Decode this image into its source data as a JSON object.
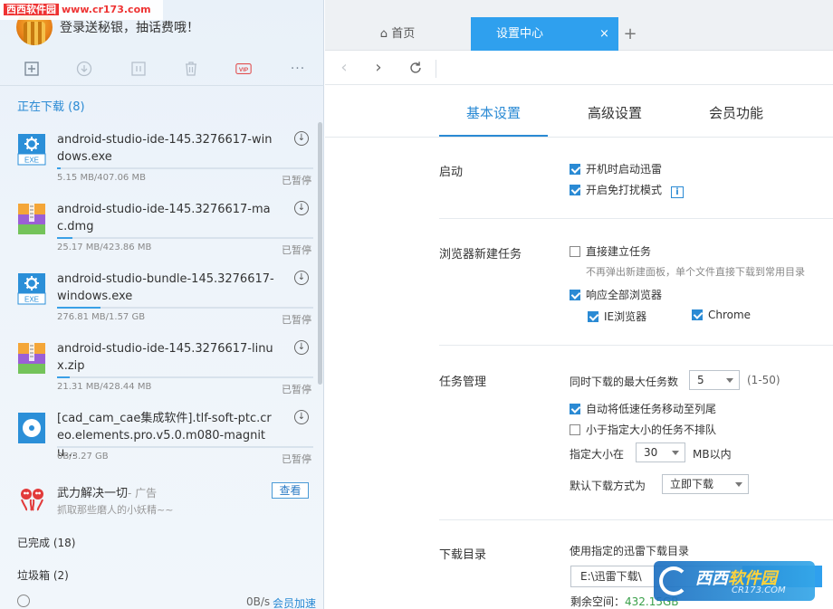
{
  "watermark": {
    "top_label": "西西软件园",
    "top_url": "www.cr173.com",
    "logo_text_a": "西西",
    "logo_text_b": "软件园",
    "logo_sub": "CR173.COM"
  },
  "user": {
    "login_prompt": "登录送秘银，抽话费哦！"
  },
  "toolbar": {
    "icons": [
      "add-task-icon",
      "download-icon",
      "pause-icon",
      "delete-icon",
      "vip-icon",
      "more-icon"
    ],
    "vip_label": "VIP",
    "more_label": "···"
  },
  "downloading": {
    "title": "正在下载 (8)",
    "items": [
      {
        "icon": "exe-icon",
        "icon_label": "EXE",
        "name": "android-studio-ide-145.3276617-windows.exe",
        "size": "5.15 MB/407.06 MB",
        "status": "已暂停",
        "progress": 0.013
      },
      {
        "icon": "archive-icon",
        "icon_label": "",
        "name": "android-studio-ide-145.3276617-mac.dmg",
        "size": "25.17 MB/423.86 MB",
        "status": "已暂停",
        "progress": 0.06
      },
      {
        "icon": "exe-icon",
        "icon_label": "EXE",
        "name": "android-studio-bundle-145.3276617-windows.exe",
        "size": "276.81 MB/1.57 GB",
        "status": "已暂停",
        "progress": 0.17
      },
      {
        "icon": "archive-icon",
        "icon_label": "",
        "name": "android-studio-ide-145.3276617-linux.zip",
        "size": "21.31 MB/428.44 MB",
        "status": "已暂停",
        "progress": 0.05
      },
      {
        "icon": "disc-icon",
        "icon_label": "",
        "name": "[cad_cam_cae集成软件].tlf-soft-ptc.creo.elements.pro.v5.0.m080-magnitu...",
        "size": "0B/3.27 GB",
        "status": "已暂停",
        "progress": 0
      }
    ]
  },
  "ad": {
    "title": "武力解决一切",
    "tag": "- 广告",
    "subtitle": "抓取那些磨人的小妖精~~",
    "button": "查看"
  },
  "sidebar": {
    "done": "已完成 (18)",
    "trash": "垃圾箱 (2)",
    "speed": "0B/s",
    "vip_accel": "会员加速"
  },
  "tabs": {
    "home": "首页",
    "active": "设置中心",
    "close": "×",
    "add": "+"
  },
  "settings_tabs": [
    "基本设置",
    "高级设置",
    "会员功能"
  ],
  "settings": {
    "startup": {
      "label": "启动",
      "opt1": "开机时启动迅雷",
      "opt2": "开启免打扰模式",
      "info": "i"
    },
    "browser": {
      "label": "浏览器新建任务",
      "direct": "直接建立任务",
      "direct_hint": "不再弹出新建面板，单个文件直接下载到常用目录",
      "respond_all": "响应全部浏览器",
      "ie": "IE浏览器",
      "chrome": "Chrome"
    },
    "task": {
      "label": "任务管理",
      "max_label": "同时下载的最大任务数",
      "max_value": "5",
      "max_range": "(1-50)",
      "auto_move": "自动将低速任务移动至列尾",
      "small_no_queue": "小于指定大小的任务不排队",
      "size_label": "指定大小在",
      "size_value": "30",
      "size_unit": "MB以内",
      "mode_label": "默认下载方式为",
      "mode_value": "立即下载"
    },
    "dir": {
      "label": "下载目录",
      "use_label": "使用指定的迅雷下载目录",
      "path": "E:\\迅雷下载\\",
      "free_label": "剩余空间：",
      "free_value": "432.15GB"
    }
  }
}
